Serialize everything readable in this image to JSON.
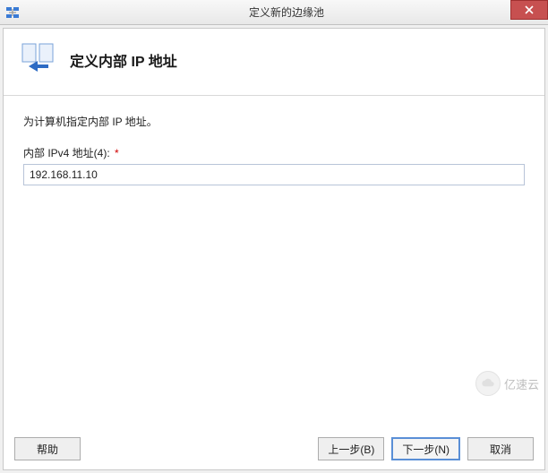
{
  "window": {
    "title": "定义新的边缘池"
  },
  "header": {
    "title": "定义内部 IP 地址"
  },
  "form": {
    "instruction": "为计算机指定内部 IP 地址。",
    "ipv4_label": "内部 IPv4 地址(4):",
    "ipv4_required": "*",
    "ipv4_value": "192.168.11.10"
  },
  "footer": {
    "help": "帮助",
    "back": "上一步(B)",
    "next": "下一步(N)",
    "cancel": "取消"
  },
  "watermark": {
    "text": "亿速云"
  }
}
